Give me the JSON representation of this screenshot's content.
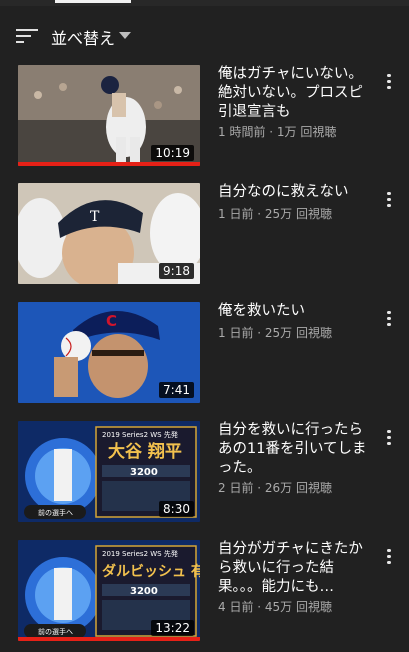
{
  "sort": {
    "label": "並べ替え"
  },
  "videos": [
    {
      "title": "俺はガチャにいない。絶対いない。プロスピ引退宣言も",
      "meta": "1 時間前 · 1万 回視聴",
      "duration": "10:19",
      "watched_fraction": 1.0
    },
    {
      "title": "自分なのに救えない",
      "meta": "1 日前 · 25万 回視聴",
      "duration": "9:18",
      "watched_fraction": 0
    },
    {
      "title": "俺を救いたい",
      "meta": "1 日前 · 25万 回視聴",
      "duration": "7:41",
      "watched_fraction": 0
    },
    {
      "title": "自分を救いに行ったらあの11番を引いてしまった。",
      "meta": "2 日前 · 26万 回視聴",
      "duration": "8:30",
      "watched_fraction": 0,
      "card": {
        "series": "2019 Series2 WS 先発",
        "name": "大谷 翔平",
        "power": "3200",
        "nav": "前の選手へ"
      }
    },
    {
      "title": "自分がガチャにきたから救いに行った結果。。。能力にも…",
      "meta": "4 日前 · 45万 回視聴",
      "duration": "13:22",
      "watched_fraction": 1.0,
      "card": {
        "series": "2019 Series2 WS 先発",
        "name": "ダルビッシュ 有",
        "power": "3200",
        "nav": "前の選手へ"
      }
    }
  ],
  "colors": {
    "background": "#212121",
    "meta_text": "#aaaaaa",
    "progress": "#e62117"
  }
}
